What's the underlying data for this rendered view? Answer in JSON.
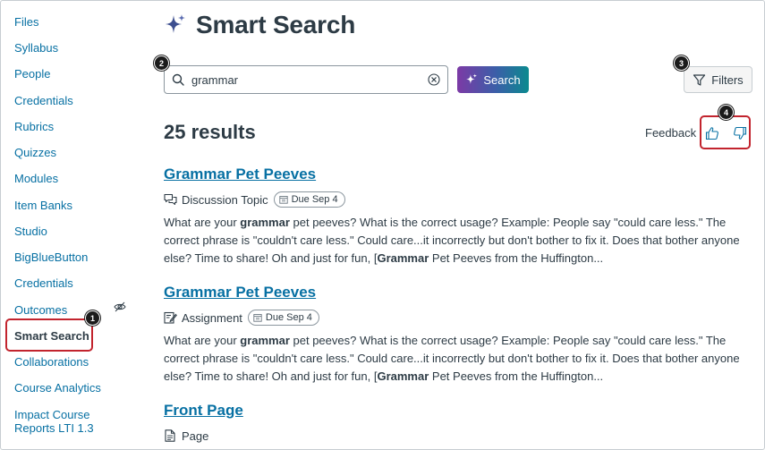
{
  "sidebar": {
    "items": [
      {
        "label": "Files"
      },
      {
        "label": "Syllabus"
      },
      {
        "label": "People"
      },
      {
        "label": "Credentials"
      },
      {
        "label": "Rubrics"
      },
      {
        "label": "Quizzes"
      },
      {
        "label": "Modules"
      },
      {
        "label": "Item Banks"
      },
      {
        "label": "Studio"
      },
      {
        "label": "BigBlueButton"
      },
      {
        "label": "Credentials"
      },
      {
        "label": "Outcomes"
      },
      {
        "label": "Smart Search"
      },
      {
        "label": "Collaborations"
      },
      {
        "label": "Course Analytics"
      },
      {
        "label": "Impact Course Reports LTI 1.3"
      }
    ],
    "active_item": "Smart Search",
    "hidden_item": "Outcomes"
  },
  "header": {
    "title": "Smart Search",
    "icon": "sparkle-icon"
  },
  "search": {
    "value": "grammar",
    "button_label": "Search",
    "filters_label": "Filters"
  },
  "results": {
    "count_label": "25 results",
    "feedback_label": "Feedback",
    "items": [
      {
        "title": "Grammar Pet Peeves",
        "type": "Discussion Topic",
        "type_icon": "discussion-icon",
        "due": "Due Sep 4",
        "snippet": [
          {
            "t": "What are your ",
            "b": false
          },
          {
            "t": "grammar",
            "b": true
          },
          {
            "t": " pet peeves? What is the correct usage? Example: People say \"could care less.\" The correct phrase is \"couldn't care less.\" Could care...it incorrectly but don't bother to fix it. Does that bother anyone else? Time to share! Oh and just for fun, [",
            "b": false
          },
          {
            "t": "Grammar",
            "b": true
          },
          {
            "t": " Pet Peeves from the Huffington...",
            "b": false
          }
        ]
      },
      {
        "title": "Grammar Pet Peeves",
        "type": "Assignment",
        "type_icon": "assignment-icon",
        "due": "Due Sep 4",
        "snippet": [
          {
            "t": "What are your ",
            "b": false
          },
          {
            "t": "grammar",
            "b": true
          },
          {
            "t": " pet peeves? What is the correct usage? Example: People say \"could care less.\" The correct phrase is \"couldn't care less.\" Could care...it incorrectly but don't bother to fix it. Does that bother anyone else? Time to share! Oh and just for fun, [",
            "b": false
          },
          {
            "t": "Grammar",
            "b": true
          },
          {
            "t": " Pet Peeves from the Huffington...",
            "b": false
          }
        ]
      },
      {
        "title": "Front Page",
        "type": "Page",
        "type_icon": "page-icon"
      }
    ]
  },
  "callouts": [
    "1",
    "2",
    "3",
    "4"
  ],
  "colors": {
    "link": "#0770a3",
    "text": "#2d3b45",
    "highlight": "#c2242e",
    "button_gradient": [
      "#7c3aa6",
      "#3a5fa8",
      "#0b8a8f"
    ]
  }
}
